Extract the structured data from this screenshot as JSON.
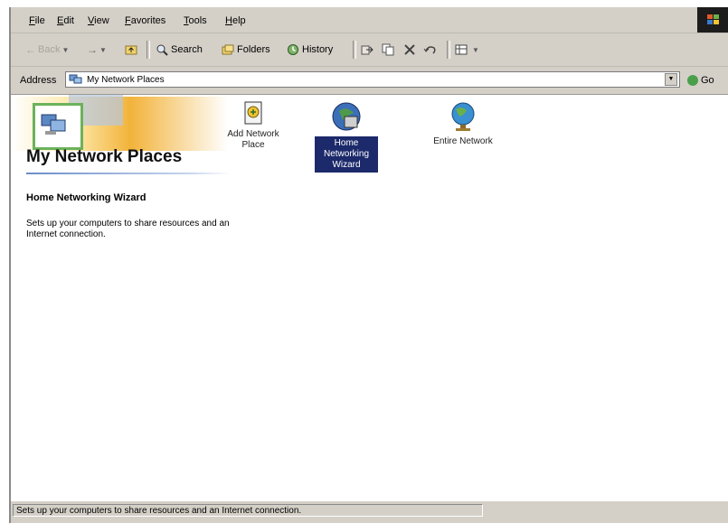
{
  "menu": [
    {
      "label": "File",
      "u": "F",
      "rest": "ile"
    },
    {
      "label": "Edit",
      "u": "E",
      "rest": "dit"
    },
    {
      "label": "View",
      "u": "V",
      "rest": "iew"
    },
    {
      "label": "Favorites",
      "u": "F",
      "rest": "avorites"
    },
    {
      "label": "Tools",
      "u": "T",
      "rest": "ools"
    },
    {
      "label": "Help",
      "u": "H",
      "rest": "elp"
    }
  ],
  "toolbar": {
    "back_label": "Back",
    "search_label": "Search",
    "folders_label": "Folders",
    "history_label": "History"
  },
  "address": {
    "label": "Address",
    "value": "My Network Places",
    "go_label": "Go"
  },
  "pane": {
    "title": "My Network Places",
    "wizard_heading": "Home Networking Wizard",
    "wizard_description": "Sets up your computers to share resources and an Internet connection."
  },
  "items": [
    {
      "label": "Add Network Place",
      "icon": "add-network-place-icon"
    },
    {
      "label": "Home Networking Wizard",
      "icon": "home-networking-wizard-icon",
      "selected": true
    },
    {
      "label": "Entire Network",
      "icon": "entire-network-globe-icon"
    }
  ],
  "status": {
    "text": "Sets up your computers to share resources and an Internet connection."
  },
  "colors": {
    "selection": "#1c2a6b",
    "chrome": "#d4d0c8"
  }
}
